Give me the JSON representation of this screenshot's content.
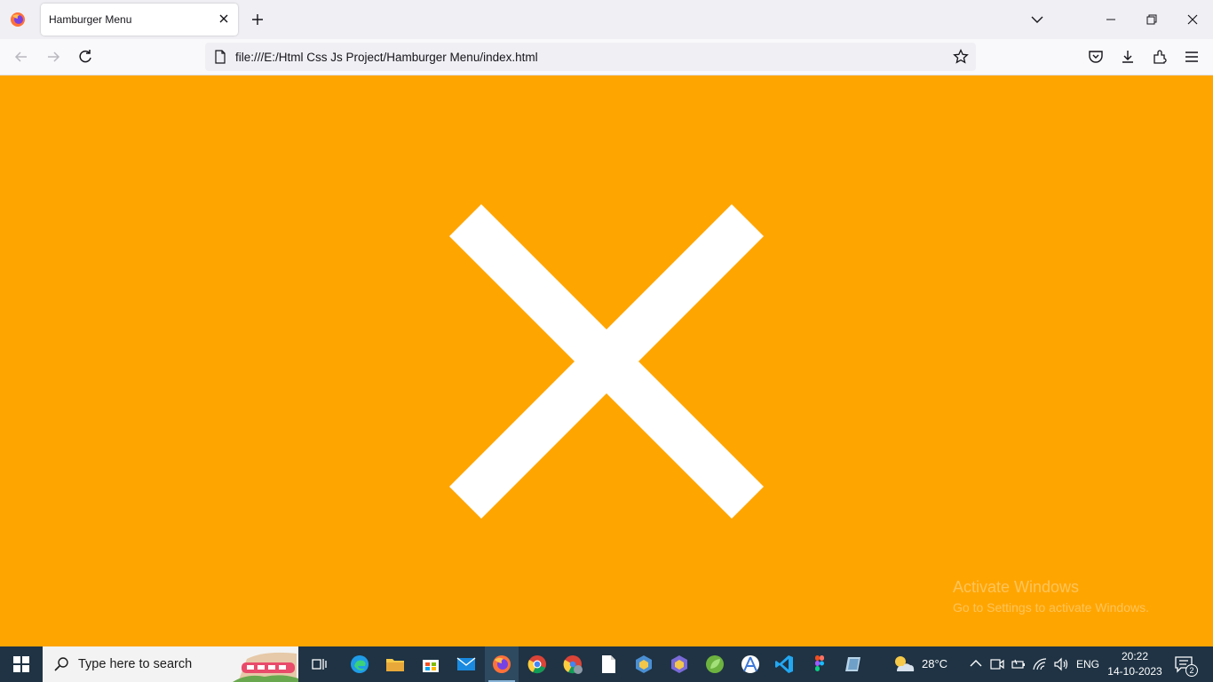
{
  "browser": {
    "tab": {
      "title": "Hamburger Menu"
    },
    "address_bar": {
      "url": "file:///E:/Html Css Js Project/Hamburger Menu/index.html"
    }
  },
  "page": {
    "background_color": "#ffa500",
    "icon": "close-x-icon",
    "watermark": {
      "line1": "Activate Windows",
      "line2": "Go to Settings to activate Windows."
    }
  },
  "taskbar": {
    "search_placeholder": "Type here to search",
    "pinned_apps": [
      "task-view",
      "edge",
      "file-explorer",
      "microsoft-store",
      "mail",
      "firefox",
      "chrome",
      "chrome-profile",
      "notepad",
      "app-cube-1",
      "app-cube-2",
      "spring-tool",
      "android-studio",
      "vs-code",
      "figma",
      "app-folder"
    ],
    "weather": "28°C",
    "language": "ENG",
    "time": "20:22",
    "date": "14-10-2023",
    "notification_count": "2"
  }
}
